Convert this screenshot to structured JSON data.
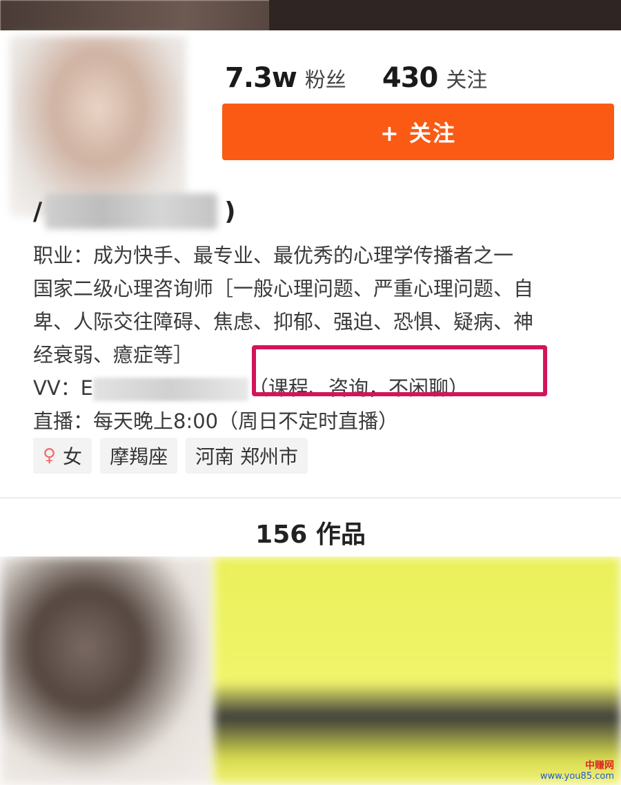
{
  "profile": {
    "fans_count": "7.3w",
    "fans_label": "粉丝",
    "following_count": "430",
    "following_label": "关注",
    "follow_button_label": "+ 关注",
    "name_start": "/",
    "name_end": ")"
  },
  "bio": {
    "lines": [
      "职业：成为快手、最专业、最优秀的心理学传播者之一",
      "国家二级心理咨询师［一般心理问题、严重心理问题、自",
      "卑、人际交往障碍、焦虑、抑郁、强迫、恐惧、疑病、神",
      "经衰弱、癔症等］"
    ],
    "vv_prefix": "VV：E",
    "vv_note": "（课程、咨询，不闲聊）",
    "live_schedule": "直播：每天晚上8:00（周日不定时直播）"
  },
  "tags": {
    "gender_icon": "female-symbol-icon",
    "gender": "女",
    "zodiac": "摩羯座",
    "location": "河南 郑州市"
  },
  "works": {
    "count_label": "156 作品"
  },
  "watermark": {
    "text": "中赚网",
    "url": "www.you85.com"
  },
  "colors": {
    "follow_button": "#fa5a13",
    "highlight_box": "#d4145a"
  }
}
